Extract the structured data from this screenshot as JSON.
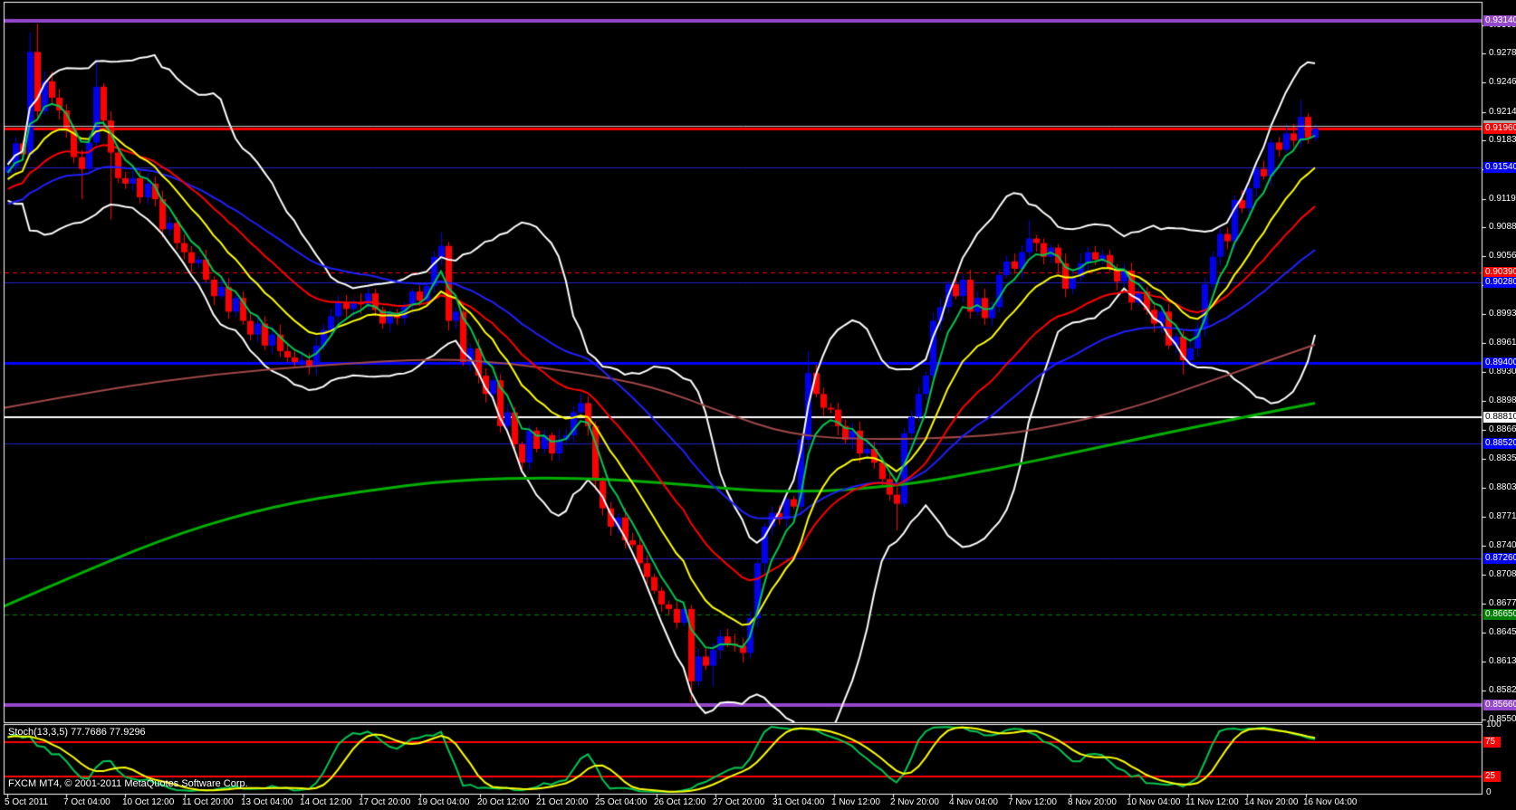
{
  "indicator_panel": {
    "label": "Stoch(13,3,5) 77.7686 77.9296",
    "axis_labels": {
      "top": "100",
      "upper": "75",
      "lower": "25",
      "bottom": "0"
    }
  },
  "copyright": "FXCM MT4, © 2001-2011 MetaQuotes Software Corp.",
  "chart_data": {
    "type": "candlestick",
    "description": "MT4 4H forex chart with Bollinger Bands, EMAs, long MAs, horizontal level lines and Stochastic(13,3,5) subwindow",
    "price_axis_ticks": [
      "0.93095",
      "0.92780",
      "0.92465",
      "0.92145",
      "0.91830",
      "0.91515",
      "0.91195",
      "0.90880",
      "0.90565",
      "0.90250",
      "0.89930",
      "0.89615",
      "0.89300",
      "0.88980",
      "0.88665",
      "0.88350",
      "0.88035",
      "0.87715",
      "0.87400",
      "0.87085",
      "0.86770",
      "0.86450",
      "0.86135",
      "0.85820",
      "0.85500"
    ],
    "time_axis_labels": [
      "5 Oct 2011",
      "7 Oct 04:00",
      "10 Oct 12:00",
      "11 Oct 20:00",
      "13 Oct 04:00",
      "14 Oct 12:00",
      "17 Oct 20:00",
      "19 Oct 04:00",
      "20 Oct 12:00",
      "21 Oct 20:00",
      "25 Oct 04:00",
      "26 Oct 12:00",
      "27 Oct 20:00",
      "31 Oct 04:00",
      "1 Nov 12:00",
      "2 Nov 20:00",
      "4 Nov 04:00",
      "7 Nov 12:00",
      "8 Nov 20:00",
      "10 Nov 04:00",
      "11 Nov 12:00",
      "14 Nov 20:00",
      "16 Nov 04:00"
    ],
    "price_lines": [
      {
        "price": 0.9314,
        "label": "0.93140",
        "color": "#9448CE",
        "width": 4,
        "style": "solid",
        "label_bg": "#9448CE",
        "label_fg": "#ffffff"
      },
      {
        "price": 0.9199,
        "label": "",
        "color": "#C8C8C8",
        "width": 1,
        "style": "solid",
        "label_bg": "#A8A8A8",
        "label_fg": "#ffffff",
        "covered": true
      },
      {
        "price": 0.9196,
        "label": "0.91960",
        "color": "#FF0000",
        "width": 3,
        "style": "solid",
        "label_bg": "#FF0000",
        "label_fg": "#ffffff"
      },
      {
        "price": 0.9154,
        "label": "0.91540",
        "color": "#2222CC",
        "width": 1,
        "style": "solid",
        "label_bg": "#0000FF",
        "label_fg": "#ffffff"
      },
      {
        "price": 0.9039,
        "label": "0.90390",
        "color": "#FF0000",
        "width": 1,
        "style": "dashed",
        "label_bg": "#FF0000",
        "label_fg": "#ffffff"
      },
      {
        "price": 0.9028,
        "label": "0.90280",
        "color": "#2222CC",
        "width": 1,
        "style": "solid",
        "label_bg": "#0000FF",
        "label_fg": "#ffffff"
      },
      {
        "price": 0.894,
        "label": "0.89400",
        "color": "#0000FF",
        "width": 3,
        "style": "solid",
        "label_bg": "#0000FF",
        "label_fg": "#ffffff"
      },
      {
        "price": 0.8881,
        "label": "0.88810",
        "color": "#FFFFFF",
        "width": 2,
        "style": "solid",
        "label_bg": "#FFFFFF",
        "label_fg": "#000000"
      },
      {
        "price": 0.8852,
        "label": "0.88520",
        "color": "#2222CC",
        "width": 1,
        "style": "solid",
        "label_bg": "#0000FF",
        "label_fg": "#ffffff"
      },
      {
        "price": 0.8726,
        "label": "0.87260",
        "color": "#2222CC",
        "width": 1,
        "style": "solid",
        "label_bg": "#0000FF",
        "label_fg": "#ffffff"
      },
      {
        "price": 0.8665,
        "label": "0.86650",
        "color": "#008000",
        "width": 1,
        "style": "dashed",
        "label_bg": "#008000",
        "label_fg": "#ffffff"
      },
      {
        "price": 0.8566,
        "label": "0.85660",
        "color": "#9448CE",
        "width": 4,
        "style": "solid",
        "label_bg": "#9448CE",
        "label_fg": "#ffffff"
      }
    ],
    "candles": {
      "count": 179,
      "first_open": 0.9148,
      "closes": [
        0.9155,
        0.918,
        0.9168,
        0.928,
        0.9215,
        0.9248,
        0.923,
        0.9216,
        0.9196,
        0.9165,
        0.9152,
        0.9181,
        0.9242,
        0.9205,
        0.917,
        0.9142,
        0.9136,
        0.9142,
        0.9121,
        0.9136,
        0.9119,
        0.9086,
        0.9093,
        0.9071,
        0.9061,
        0.9049,
        0.9053,
        0.9031,
        0.9013,
        0.9023,
        0.8996,
        0.9011,
        0.8986,
        0.8971,
        0.8983,
        0.8959,
        0.8971,
        0.8953,
        0.8946,
        0.8941,
        0.8943,
        0.8936,
        0.8959,
        0.8976,
        0.8991,
        0.9006,
        0.8999,
        0.9006,
        0.9004,
        0.9016,
        0.8998,
        0.8983,
        0.8995,
        0.8989,
        0.9003,
        0.9018,
        0.9008,
        0.9024,
        0.9056,
        0.9068,
        0.8986,
        0.8996,
        0.8941,
        0.8956,
        0.8926,
        0.8906,
        0.8921,
        0.8871,
        0.8886,
        0.8851,
        0.8831,
        0.8866,
        0.8846,
        0.8861,
        0.8841,
        0.8856,
        0.8861,
        0.8886,
        0.8896,
        0.8871,
        0.8811,
        0.8781,
        0.8761,
        0.8771,
        0.8746,
        0.8741,
        0.8721,
        0.8706,
        0.8691,
        0.8676,
        0.8671,
        0.8656,
        0.8671,
        0.8592,
        0.8619,
        0.8609,
        0.8626,
        0.8641,
        0.8633,
        0.8631,
        0.8623,
        0.8661,
        0.8721,
        0.8761,
        0.8776,
        0.8769,
        0.8791,
        0.8783,
        0.8856,
        0.8929,
        0.8906,
        0.8891,
        0.8889,
        0.8871,
        0.8856,
        0.8866,
        0.8841,
        0.8846,
        0.8831,
        0.8813,
        0.8796,
        0.8786,
        0.8863,
        0.8881,
        0.8906,
        0.8926,
        0.8986,
        0.9001,
        0.9026,
        0.9013,
        0.9031,
        0.8996,
        0.9011,
        0.8989,
        0.9001,
        0.9036,
        0.9051,
        0.9043,
        0.9061,
        0.9076,
        0.9071,
        0.9056,
        0.9066,
        0.9049,
        0.9021,
        0.9034,
        0.9049,
        0.9061,
        0.9053,
        0.9058,
        0.9043,
        0.9029,
        0.9041,
        0.9006,
        0.9018,
        0.8998,
        0.8983,
        0.8996,
        0.8959,
        0.8969,
        0.8943,
        0.8956,
        0.8978,
        0.9026,
        0.9056,
        0.9081,
        0.9073,
        0.9118,
        0.9109,
        0.9131,
        0.9152,
        0.9144,
        0.9181,
        0.9173,
        0.9191,
        0.9183,
        0.9209,
        0.9186,
        0.9196
      ],
      "wick_overrides": [
        {
          "i": 3,
          "high": 0.9301
        },
        {
          "i": 4,
          "high": 0.9311
        },
        {
          "i": 10,
          "low": 0.9119
        },
        {
          "i": 12,
          "high": 0.9272
        },
        {
          "i": 14,
          "low": 0.9097
        },
        {
          "i": 41,
          "low": 0.8927
        },
        {
          "i": 59,
          "high": 0.9083
        },
        {
          "i": 93,
          "low": 0.8569
        },
        {
          "i": 96,
          "low": 0.8587
        },
        {
          "i": 109,
          "high": 0.8953
        },
        {
          "i": 121,
          "low": 0.8757
        },
        {
          "i": 139,
          "high": 0.9096
        },
        {
          "i": 160,
          "low": 0.8927
        },
        {
          "i": 176,
          "high": 0.9228
        }
      ]
    },
    "overlays": {
      "bollinger": {
        "period": 18,
        "deviation": 2,
        "color": "#FFFFFF",
        "width": 2
      },
      "emas": [
        {
          "name": "fast",
          "period": 5,
          "color": "#00C853",
          "width": 2
        },
        {
          "name": "mid",
          "period": 13,
          "color": "#FFFF00",
          "width": 2
        },
        {
          "name": "slow",
          "period": 25,
          "color": "#FF0000",
          "width": 2
        },
        {
          "name": "long",
          "period": 45,
          "color": "#2020FF",
          "width": 2
        }
      ],
      "ma_brown": {
        "color": "#A04848",
        "width": 2,
        "anchors": [
          [
            0,
            0.889
          ],
          [
            120,
            0.8912
          ],
          [
            240,
            0.8928
          ],
          [
            360,
            0.8938
          ],
          [
            480,
            0.8945
          ],
          [
            560,
            0.894
          ],
          [
            640,
            0.8929
          ],
          [
            720,
            0.8915
          ],
          [
            800,
            0.8885
          ],
          [
            870,
            0.8862
          ],
          [
            950,
            0.8856
          ],
          [
            1083,
            0.8859
          ],
          [
            1150,
            0.8868
          ],
          [
            1250,
            0.889
          ],
          [
            1350,
            0.8925
          ],
          [
            1452,
            0.896
          ]
        ]
      },
      "sma_green": {
        "color": "#00B000",
        "width": 3,
        "anchors": [
          [
            0,
            0.8672
          ],
          [
            100,
            0.8715
          ],
          [
            200,
            0.8755
          ],
          [
            300,
            0.8783
          ],
          [
            400,
            0.88
          ],
          [
            500,
            0.8812
          ],
          [
            620,
            0.8815
          ],
          [
            720,
            0.881
          ],
          [
            870,
            0.8797
          ],
          [
            1000,
            0.8806
          ],
          [
            1100,
            0.8824
          ],
          [
            1200,
            0.8845
          ],
          [
            1300,
            0.8866
          ],
          [
            1380,
            0.8882
          ],
          [
            1452,
            0.8896
          ]
        ]
      }
    },
    "stochastic": {
      "k_period": 13,
      "slowing": 3,
      "d_period": 5,
      "current_main": 77.7686,
      "current_signal": 77.9296,
      "upper_level": 75,
      "lower_level": 25,
      "end_value": 78,
      "main_color": "#00C853",
      "signal_color": "#FFFF00",
      "level_color": "#FF0000"
    },
    "colors": {
      "background": "#000000",
      "border": "#FFFFFF",
      "bull": "#0000EE",
      "bear": "#FF0000",
      "axis_text": "#FFFFFF"
    }
  }
}
